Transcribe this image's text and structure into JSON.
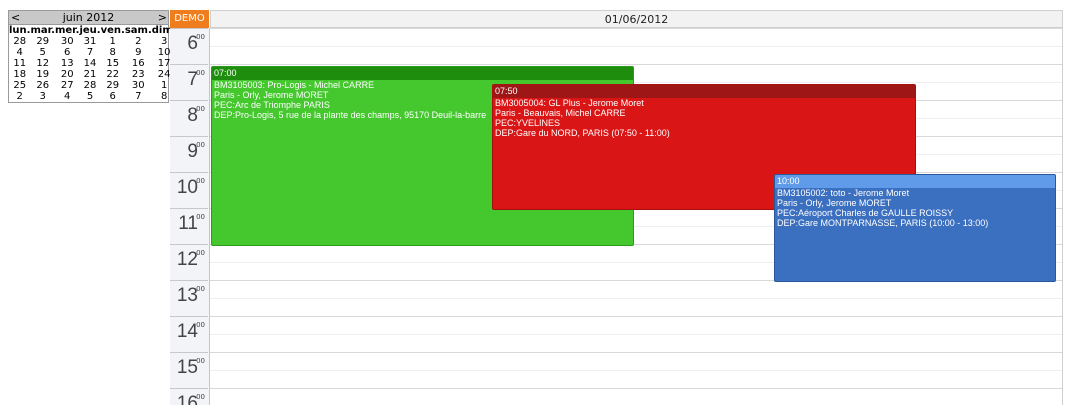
{
  "mini_calendar": {
    "prev": "<",
    "next": ">",
    "month_label": "juin 2012",
    "weekdays": [
      "lun.",
      "mar.",
      "mer.",
      "jeu.",
      "ven.",
      "sam.",
      "dim."
    ],
    "weeks": [
      [
        "28",
        "29",
        "30",
        "31",
        "1",
        "2",
        "3"
      ],
      [
        "4",
        "5",
        "6",
        "7",
        "8",
        "9",
        "10"
      ],
      [
        "11",
        "12",
        "13",
        "14",
        "15",
        "16",
        "17"
      ],
      [
        "18",
        "19",
        "20",
        "21",
        "22",
        "23",
        "24"
      ],
      [
        "25",
        "26",
        "27",
        "28",
        "29",
        "30",
        "1"
      ],
      [
        "2",
        "3",
        "4",
        "5",
        "6",
        "7",
        "8"
      ]
    ]
  },
  "demo_tag": "DEMO",
  "day_header": "01/06/2012",
  "hours": [
    {
      "h": "6",
      "m": "00"
    },
    {
      "h": "7",
      "m": "00"
    },
    {
      "h": "8",
      "m": "00"
    },
    {
      "h": "9",
      "m": "00"
    },
    {
      "h": "10",
      "m": "00"
    },
    {
      "h": "11",
      "m": "00"
    },
    {
      "h": "12",
      "m": "00"
    },
    {
      "h": "13",
      "m": "00"
    },
    {
      "h": "14",
      "m": "00"
    },
    {
      "h": "15",
      "m": "00"
    },
    {
      "h": "16",
      "m": "00"
    }
  ],
  "events": [
    {
      "time": "07:00",
      "title": "BM3105003: Pro-Logis - Michel CARRE",
      "route": "Paris - Orly, Jerome MORET",
      "pec": "PEC:Arc de Triomphe PARIS",
      "dep": "DEP:Pro-Logis, 5 rue de la plante des champs, 95170 Deuil-la-barre",
      "color": "#44c82e",
      "header_color": "#1e8c0d"
    },
    {
      "time": "07:50",
      "title": "BM3005004: GL Plus - Jerome Moret",
      "route": "Paris - Beauvais, Michel CARRE",
      "pec": "PEC:YVELINES",
      "dep": "DEP:Gare du NORD, PARIS (07:50 - 11:00)",
      "color": "#d91515",
      "header_color": "#9e1616"
    },
    {
      "time": "10:00",
      "title": "BM3105002: toto - Jerome Moret",
      "route": "Paris - Orly, Jerome MORET",
      "pec": "PEC:Aéroport Charles de GAULLE ROISSY",
      "dep": "DEP:Gare MONTPARNASSE, PARIS (10:00 - 13:00)",
      "color": "#3b6fc0",
      "header_color": "#5f9be9"
    }
  ],
  "colors": {
    "demo_tag": "#ef7d1e",
    "timebar_bg": "#f2f4f7",
    "header_bg": "#f2f2f2"
  }
}
